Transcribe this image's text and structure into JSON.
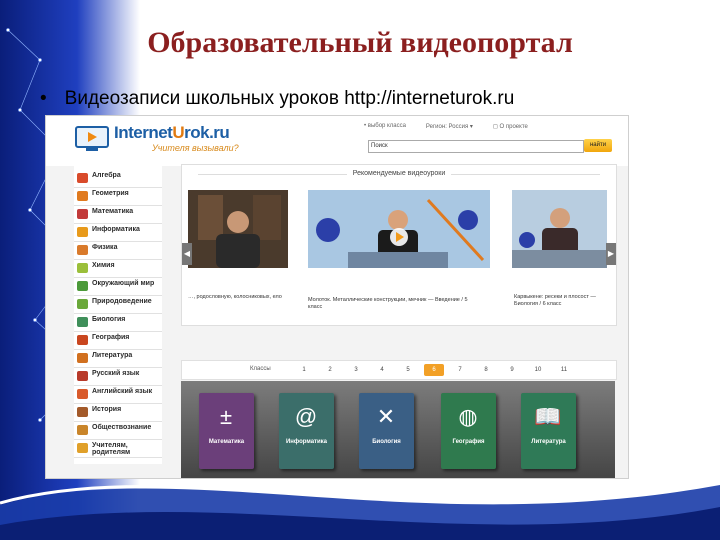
{
  "slide": {
    "title": "Образовательный видеопортал",
    "bullet": "•",
    "text": "Видеозаписи школьных уроков http://interneturok.ru"
  },
  "site": {
    "logo_main": "Internet",
    "logo_accent": "U",
    "logo_rest": "rok.ru",
    "tagline": "Учителя вызывали?",
    "top_links": [
      "• выбор класса",
      "Регион: Россия ▾",
      "◻ О проекте"
    ],
    "search_value": "Поиск",
    "search_button": "найти",
    "sidebar": [
      {
        "label": "Алгебра",
        "color": "#d94b2b"
      },
      {
        "label": "Геометрия",
        "color": "#e07a1f"
      },
      {
        "label": "Математика",
        "color": "#c23a3a"
      },
      {
        "label": "Информатика",
        "color": "#e89a1b"
      },
      {
        "label": "Физика",
        "color": "#d97a2b"
      },
      {
        "label": "Химия",
        "color": "#9bbf3a"
      },
      {
        "label": "Окружающий мир",
        "color": "#4c9a3a"
      },
      {
        "label": "Природоведение",
        "color": "#6aa83a"
      },
      {
        "label": "Биология",
        "color": "#3f8f5a"
      },
      {
        "label": "География",
        "color": "#c9461f"
      },
      {
        "label": "Литература",
        "color": "#d1701f"
      },
      {
        "label": "Русский язык",
        "color": "#b83a2a"
      },
      {
        "label": "Английский язык",
        "color": "#d95a2b"
      },
      {
        "label": "История",
        "color": "#a35a2a"
      },
      {
        "label": "Обществознание",
        "color": "#c9852a"
      },
      {
        "label": "Учителям, родителям",
        "color": "#e0a02a"
      }
    ],
    "reco_title": "Рекомендуемые видеоуроки",
    "videos": [
      {
        "caption": "…, родословную, колосниковых, ело"
      },
      {
        "caption": "Молоток. Металлические конструкции, мечник — Введение / 5 класс"
      },
      {
        "caption": "Карвыкене: ресеки и плосост — Биология / 6 класс"
      }
    ],
    "classes_label": "Классы",
    "classes": [
      "1",
      "2",
      "3",
      "4",
      "5",
      "6",
      "7",
      "8",
      "9",
      "10",
      "11"
    ],
    "active_class": "6",
    "books": [
      {
        "label": "Математика",
        "icon": "±",
        "color": "#6b3f7a"
      },
      {
        "label": "Информатика",
        "icon": "@",
        "color": "#3b6e6a"
      },
      {
        "label": "Биология",
        "icon": "✕",
        "color": "#3a5f85"
      },
      {
        "label": "География",
        "icon": "◍",
        "color": "#2f7a4e"
      },
      {
        "label": "Литература",
        "icon": "📖",
        "color": "#2f7a57"
      }
    ]
  }
}
